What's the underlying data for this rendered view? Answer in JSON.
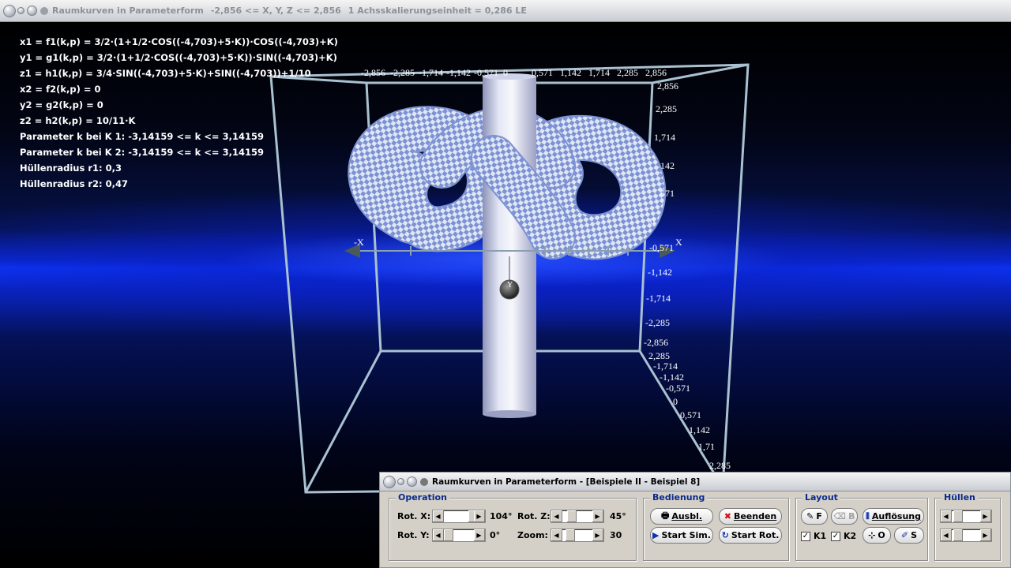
{
  "window": {
    "title": "Raumkurven in Parameterform",
    "range": "-2,856 <= X, Y, Z <= 2,856",
    "scale": "1 Achsskalierungseinheit = 0,286 LE"
  },
  "formulas": [
    "x1 = f1(k,p) = 3/2·(1+1/2·COS((-4,703)+5·K))·COS((-4,703)+K)",
    "y1 = g1(k,p) = 3/2·(1+1/2·COS((-4,703)+5·K))·SIN((-4,703)+K)",
    "z1 = h1(k,p) = 3/4·SIN((-4,703)+5·K)+SIN((-4,703))+1/10",
    "x2 = f2(k,p) = 0",
    "y2 = g2(k,p) = 0",
    "z2 = h2(k,p) = 10/11·K",
    "Parameter k bei K 1: -3,14159 <= k <= 3,14159",
    "Parameter k bei K 2: -3,14159 <= k <= 3,14159",
    "Hüllenradius r1: 0,3",
    "Hüllenradius r2: 0,47"
  ],
  "axes": {
    "top_ticks": [
      "-2,856",
      "-2,285",
      "-1,714",
      "-1,142",
      "-0,571",
      "0",
      "0,571",
      "1,142",
      "1,714",
      "2,285",
      "2,856"
    ],
    "right_ticks": [
      "2,856",
      "2,285",
      "1,714",
      "142",
      "571",
      "0",
      "-0,571",
      "-1,142",
      "-1,714",
      "-2,285",
      "-2,856"
    ],
    "depth_ticks": [
      "2,285",
      "-1,714",
      "-1,142",
      "-0,571",
      "0",
      "0,571",
      "1,142",
      "1,71",
      "2,285"
    ],
    "x_label": "X",
    "neg_x_label": "-X",
    "y_label": "Y"
  },
  "control": {
    "title": "Raumkurven in Parameterform - [Beispiele II - Beispiel 8]",
    "operation": {
      "label": "Operation",
      "rot_x_label": "Rot. X:",
      "rot_x_value": "104°",
      "rot_y_label": "Rot. Y:",
      "rot_y_value": "0°",
      "rot_z_label": "Rot. Z:",
      "rot_z_value": "45°",
      "zoom_label": "Zoom:",
      "zoom_value": "30"
    },
    "bedienung": {
      "label": "Bedienung",
      "ausbl": "Ausbl.",
      "beenden": "Beenden",
      "start_sim": "Start Sim.",
      "start_rot": "Start Rot."
    },
    "layout": {
      "label": "Layout",
      "f_btn": "F",
      "b_btn": "B",
      "aufloesung": "Auflösung",
      "k1": "K1",
      "k2": "K2",
      "o_btn": "O",
      "s_btn": "S"
    },
    "huellen": {
      "label": "Hüllen"
    }
  }
}
